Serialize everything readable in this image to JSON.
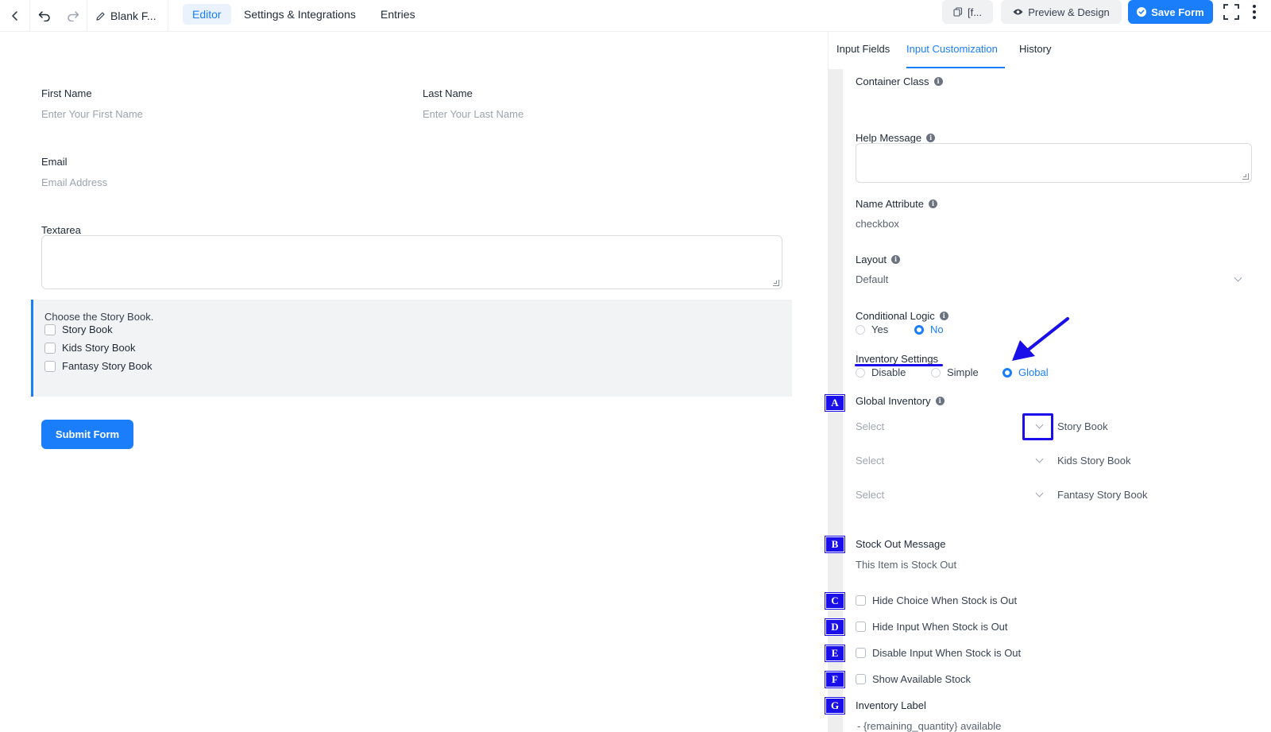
{
  "topbar": {
    "form_title": "Blank F...",
    "tabs": [
      {
        "label": "Editor",
        "active": true
      },
      {
        "label": "Settings & Integrations",
        "active": false
      },
      {
        "label": "Entries",
        "active": false
      }
    ],
    "shortcode_label": "[f...",
    "preview_label": "Preview & Design",
    "save_label": "Save Form"
  },
  "form": {
    "first_name": {
      "label": "First Name",
      "placeholder": "Enter Your First Name"
    },
    "last_name": {
      "label": "Last Name",
      "placeholder": "Enter Your Last Name"
    },
    "email": {
      "label": "Email",
      "placeholder": "Email Address"
    },
    "textarea": {
      "label": "Textarea"
    },
    "checkbox_group": {
      "label": "Choose the Story Book.",
      "options": [
        "Story Book",
        "Kids Story Book",
        "Fantasy Story Book"
      ]
    },
    "submit_label": "Submit Form"
  },
  "panel": {
    "tabs": [
      {
        "label": "Input Fields",
        "active": false
      },
      {
        "label": "Input Customization",
        "active": true
      },
      {
        "label": "History",
        "active": false
      }
    ],
    "container_class": {
      "label": "Container Class"
    },
    "help_message": {
      "label": "Help Message"
    },
    "name_attribute": {
      "label": "Name Attribute",
      "value": "checkbox"
    },
    "layout": {
      "label": "Layout",
      "value": "Default"
    },
    "conditional_logic": {
      "label": "Conditional Logic",
      "options": [
        "Yes",
        "No"
      ],
      "selected": "No"
    },
    "inventory_settings": {
      "label": "Inventory Settings",
      "options": [
        "Disable",
        "Simple",
        "Global"
      ],
      "selected": "Global"
    },
    "global_inventory": {
      "label": "Global Inventory",
      "rows": [
        {
          "select_placeholder": "Select",
          "item": "Story Book"
        },
        {
          "select_placeholder": "Select",
          "item": "Kids Story Book"
        },
        {
          "select_placeholder": "Select",
          "item": "Fantasy Story Book"
        }
      ]
    },
    "stock_out_message": {
      "label": "Stock Out Message",
      "value": "This Item is Stock Out"
    },
    "checkboxes": [
      {
        "label": "Hide Choice When Stock is Out",
        "checked": false
      },
      {
        "label": "Hide Input When Stock is Out",
        "checked": false
      },
      {
        "label": "Disable Input When Stock is Out",
        "checked": false
      },
      {
        "label": "Show Available Stock",
        "checked": false
      }
    ],
    "inventory_label": {
      "label": "Inventory Label",
      "value": "- {remaining_quantity} available"
    }
  },
  "annotations": {
    "markers": [
      "A",
      "B",
      "C",
      "D",
      "E",
      "F",
      "G"
    ],
    "color": "#1a0fe8"
  },
  "colors": {
    "accent": "#1a7efb",
    "annotation": "#1a0fe8"
  }
}
